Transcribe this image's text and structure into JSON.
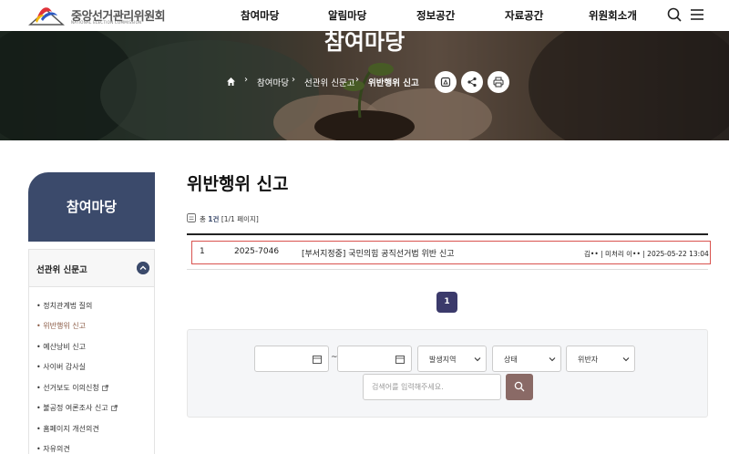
{
  "header": {
    "logo_text": "중앙선거관리위원회",
    "logo_sub": "NATIONAL ELECTION COMMISSION",
    "nav": [
      "참여마당",
      "알림마당",
      "정보공간",
      "자료공간",
      "위원회소개"
    ]
  },
  "banner": {
    "title": "참여마당",
    "breadcrumb": [
      "참여마당",
      "선관위 신문고",
      "위반행위 신고"
    ]
  },
  "sidebar": {
    "title": "참여마당",
    "section": "선관위 신문고",
    "items": [
      {
        "label": "정치관계법 질의",
        "active": false,
        "external": false
      },
      {
        "label": "위반행위 신고",
        "active": true,
        "external": false
      },
      {
        "label": "예산낭비 신고",
        "active": false,
        "external": false
      },
      {
        "label": "사이버 감사실",
        "active": false,
        "external": false
      },
      {
        "label": "선거보도 이의신청",
        "active": false,
        "external": true
      },
      {
        "label": "불공정 여론조사 신고",
        "active": false,
        "external": true
      },
      {
        "label": "홈페이지 개선의견",
        "active": false,
        "external": false
      },
      {
        "label": "자유의견",
        "active": false,
        "external": false
      }
    ]
  },
  "main": {
    "title": "위반행위 신고",
    "count_prefix": "총",
    "count_value": "1건",
    "count_pages": "[1/1 페이지]",
    "rows": [
      {
        "no": "1",
        "id": "2025-7046",
        "title": "[부서지정중] 국민의힘 공직선거법 위반 신고",
        "meta": "김•• | 미처리 이•• | 2025-05-22 13:04"
      }
    ],
    "page": "1"
  },
  "search": {
    "region_label": "발생지역",
    "status_label": "상태",
    "violator_label": "위반자",
    "separator": "~",
    "keyword_placeholder": "검색어를 입력해주세요."
  },
  "colors": {
    "navy": "#3b4a6b",
    "highlight_border": "#d9534f",
    "search_button": "#8a6a66"
  }
}
